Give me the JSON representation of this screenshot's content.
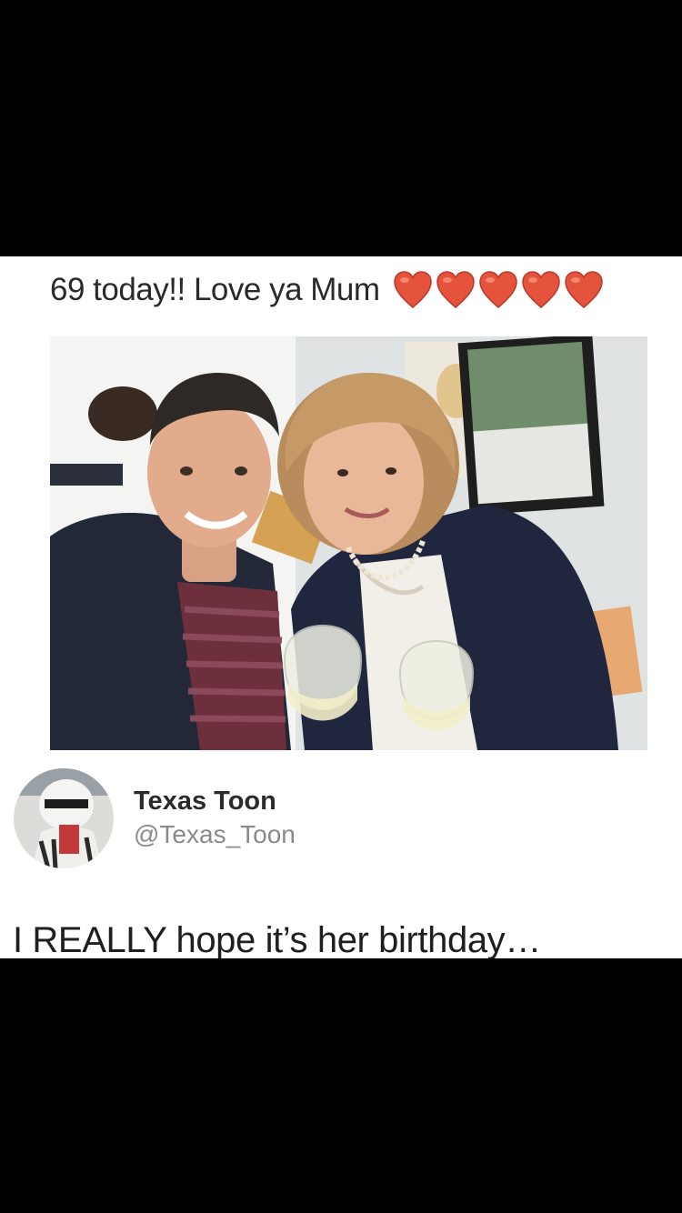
{
  "post": {
    "caption": "69 today!! Love ya Mum",
    "caption_hearts": [
      "heart-emoji",
      "heart-emoji",
      "heart-emoji",
      "heart-emoji",
      "heart-emoji"
    ],
    "heart_color": "#e5533d"
  },
  "author": {
    "name": "Texas Toon",
    "handle": "@Texas_Toon"
  },
  "comment": "I REALLY hope it’s her birthday…"
}
